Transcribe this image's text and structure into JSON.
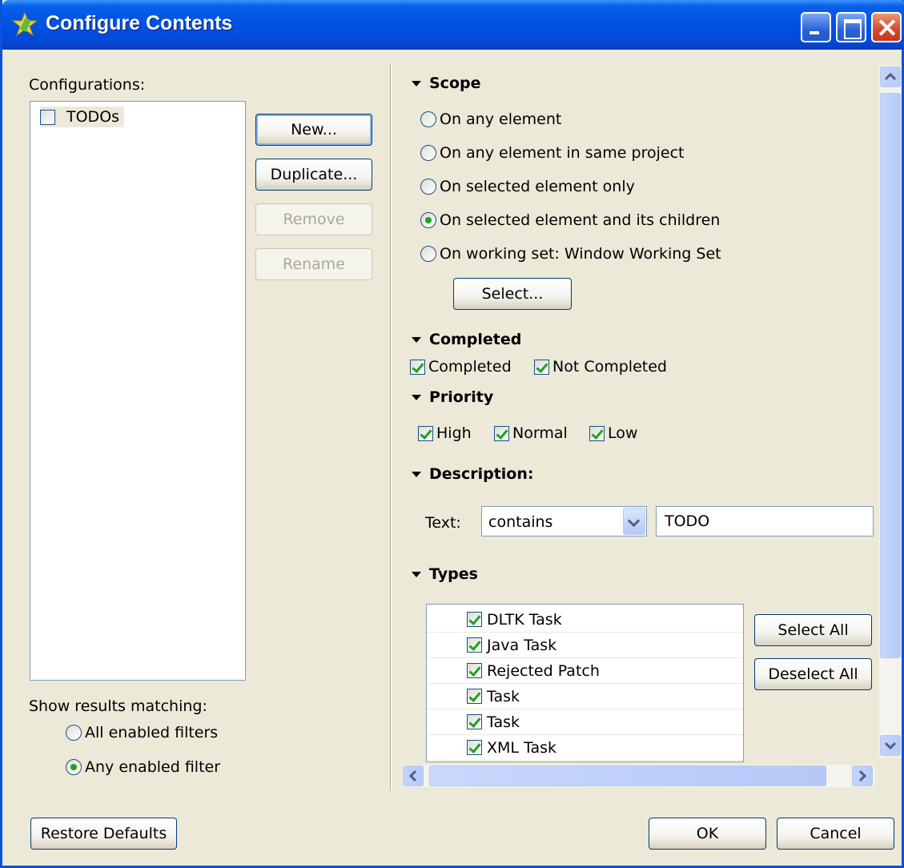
{
  "window": {
    "title": "Configure Contents",
    "colors": {
      "titlebar": "#0055e5",
      "face": "#ece9d8",
      "check": "#21a121"
    }
  },
  "left": {
    "configurations_label": "Configurations:",
    "configurations": [
      {
        "label": "TODOs",
        "checked": false
      }
    ],
    "buttons": {
      "new": "New...",
      "duplicate": "Duplicate...",
      "remove": "Remove",
      "rename": "Rename"
    },
    "show_results_label": "Show results matching:",
    "match_options": [
      {
        "label": "All enabled filters",
        "selected": false
      },
      {
        "label": "Any enabled filter",
        "selected": true
      }
    ]
  },
  "scope": {
    "heading": "Scope",
    "options": [
      {
        "label": "On any element",
        "selected": false
      },
      {
        "label": "On any element in same project",
        "selected": false
      },
      {
        "label": "On selected element only",
        "selected": false
      },
      {
        "label": "On selected element and its children",
        "selected": true
      },
      {
        "label": "On working set:  Window Working Set",
        "selected": false
      }
    ],
    "select_button": "Select..."
  },
  "completed": {
    "heading": "Completed",
    "options": [
      {
        "label": "Completed",
        "checked": true
      },
      {
        "label": "Not Completed",
        "checked": true
      }
    ]
  },
  "priority": {
    "heading": "Priority",
    "options": [
      {
        "label": "High",
        "checked": true
      },
      {
        "label": "Normal",
        "checked": true
      },
      {
        "label": "Low",
        "checked": true
      }
    ]
  },
  "description": {
    "heading": "Description:",
    "text_label": "Text:",
    "operator": "contains",
    "value": "TODO"
  },
  "types": {
    "heading": "Types",
    "items": [
      {
        "label": "DLTK Task",
        "checked": true
      },
      {
        "label": "Java Task",
        "checked": true
      },
      {
        "label": "Rejected Patch",
        "checked": true
      },
      {
        "label": "Task",
        "checked": true
      },
      {
        "label": "Task",
        "checked": true
      },
      {
        "label": "XML Task",
        "checked": true
      }
    ],
    "select_all": "Select All",
    "deselect_all": "Deselect All"
  },
  "footer": {
    "restore_defaults": "Restore Defaults",
    "ok": "OK",
    "cancel": "Cancel"
  },
  "icons": [
    "configure-contents-icon",
    "minimize-icon",
    "maximize-icon",
    "close-icon",
    "collapse-triangle-icon",
    "scroll-up-arrow-icon",
    "scroll-down-arrow-icon",
    "scroll-left-arrow-icon",
    "scroll-right-arrow-icon",
    "dropdown-arrow-icon"
  ]
}
